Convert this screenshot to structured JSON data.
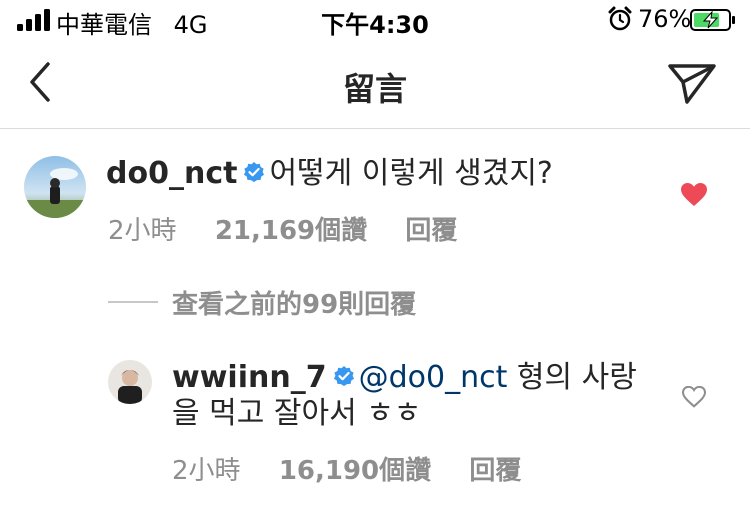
{
  "status_bar": {
    "carrier": "中華電信",
    "network": "4G",
    "time": "下午4:30",
    "battery_percent": "76%",
    "battery_level": 0.76
  },
  "header": {
    "title": "留言"
  },
  "comments": [
    {
      "username": "do0_nct",
      "verified": true,
      "text": "어떻게 이렇게 생겼지?",
      "time": "2小時",
      "likes": "21,169個讚",
      "reply_label": "回覆",
      "liked": true
    }
  ],
  "view_replies": "查看之前的99則回覆",
  "replies": [
    {
      "username": "wwiinn_7",
      "verified": true,
      "mention": "@do0_nct",
      "text_line1": "형의 사랑",
      "text_line2": "을 먹고 잘아서 ㅎㅎ",
      "time": "2小時",
      "likes": "16,190個讚",
      "reply_label": "回覆",
      "liked": false
    }
  ],
  "colors": {
    "text": "#262626",
    "secondary": "#8e8e8e",
    "mention": "#00376b",
    "verified": "#3897f0",
    "liked_heart": "#ed4956",
    "battery_fill": "#4cd964"
  }
}
